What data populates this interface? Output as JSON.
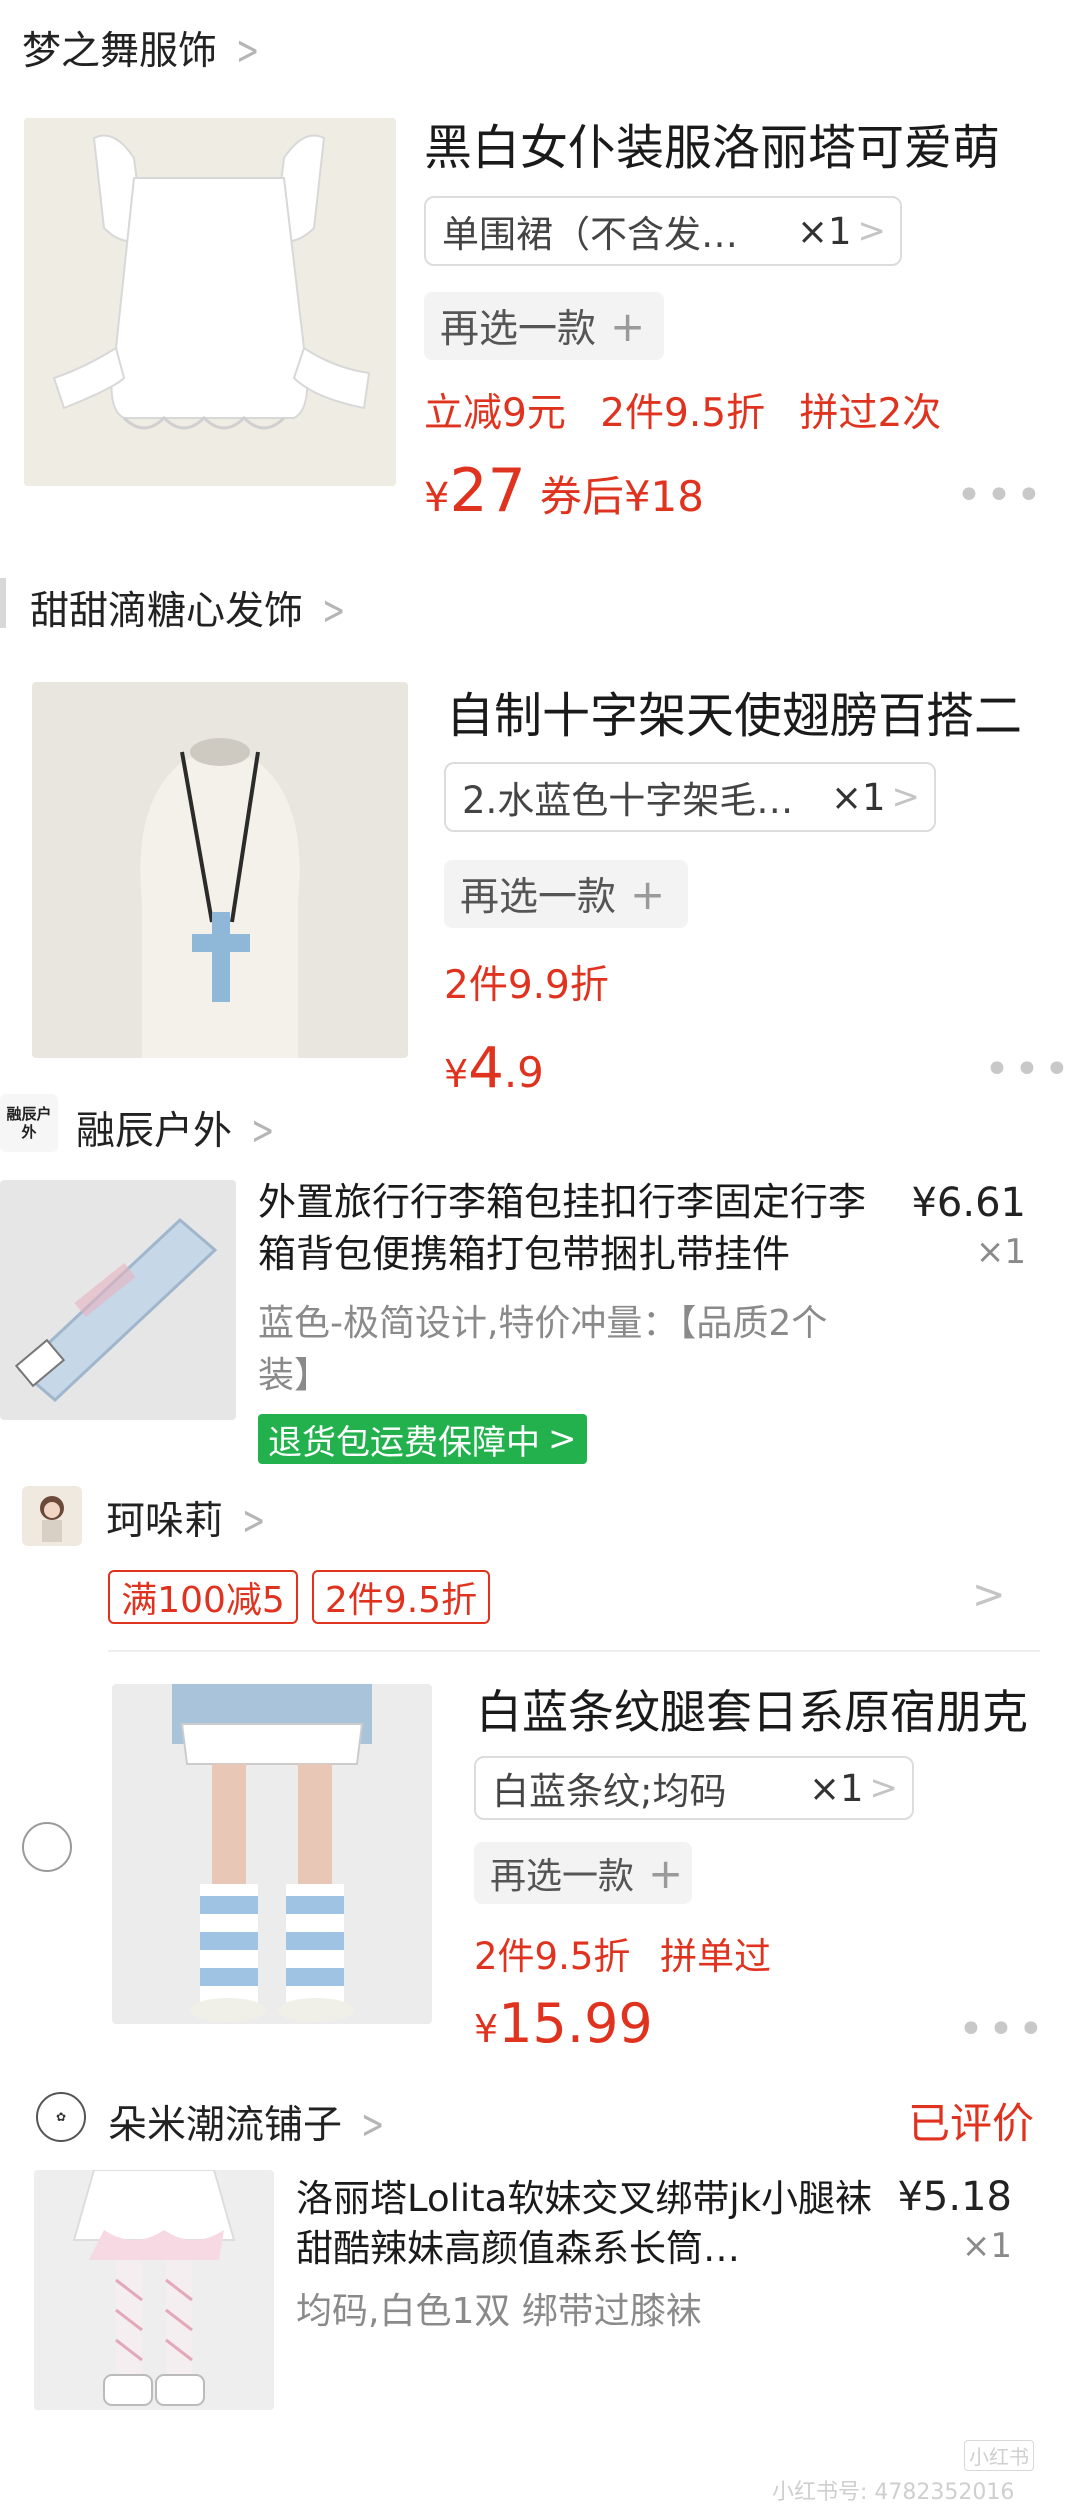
{
  "colors": {
    "accent": "#e0331f",
    "green_badge": "#22b14c"
  },
  "shop1": {
    "name": "梦之舞服饰",
    "item": {
      "title": "黑白女仆装服洛丽塔可爱萌",
      "sku": "单围裙（不含发…",
      "qty": "×1",
      "reselect": "再选一款",
      "promos": [
        "立减9元",
        "2件9.5折",
        "拼过2次"
      ],
      "price_symbol": "¥",
      "price": "27",
      "coupon_price": "券后¥18",
      "more": "•••"
    }
  },
  "shop2": {
    "name": "甜甜滴糖心发饰",
    "item": {
      "title": "自制十字架天使翅膀百搭二",
      "sku": "2.水蓝色十字架毛…",
      "qty": "×1",
      "reselect": "再选一款",
      "promo": "2件9.9折",
      "price_symbol": "¥",
      "price_int": "4",
      "price_dec": ".9",
      "more": "•••"
    }
  },
  "shop3": {
    "logo_text": "融辰户外",
    "name": "融辰户外",
    "item": {
      "desc": "外置旅行行李箱包挂扣行李固定行李箱背包便携箱打包带捆扎带挂件",
      "spec": "蓝色-极简设计,特价冲量：【品质2个装】",
      "price": "¥6.61",
      "qty": "×1",
      "badge": "退货包运费保障中"
    }
  },
  "shop4": {
    "name": "珂哚莉",
    "tags": [
      "满100减5",
      "2件9.5折"
    ],
    "item": {
      "title": "白蓝条纹腿套日系原宿朋克",
      "sku": "白蓝条纹;均码",
      "qty": "×1",
      "reselect": "再选一款",
      "promos": [
        "2件9.5折",
        "拼单过"
      ],
      "price_symbol": "¥",
      "price": "15.99",
      "more": "•••"
    }
  },
  "shop5": {
    "name": "朵米潮流铺子",
    "status": "已评价",
    "item": {
      "desc": "洛丽塔Lolita软妹交叉绑带jk小腿袜甜酷辣妹高颜值森系长筒…",
      "spec": "均码,白色1双 绑带过膝袜",
      "price": "¥5.18",
      "qty": "×1"
    }
  },
  "watermark": {
    "line1": "小红书",
    "line2": "小红书号: 4782352016"
  }
}
